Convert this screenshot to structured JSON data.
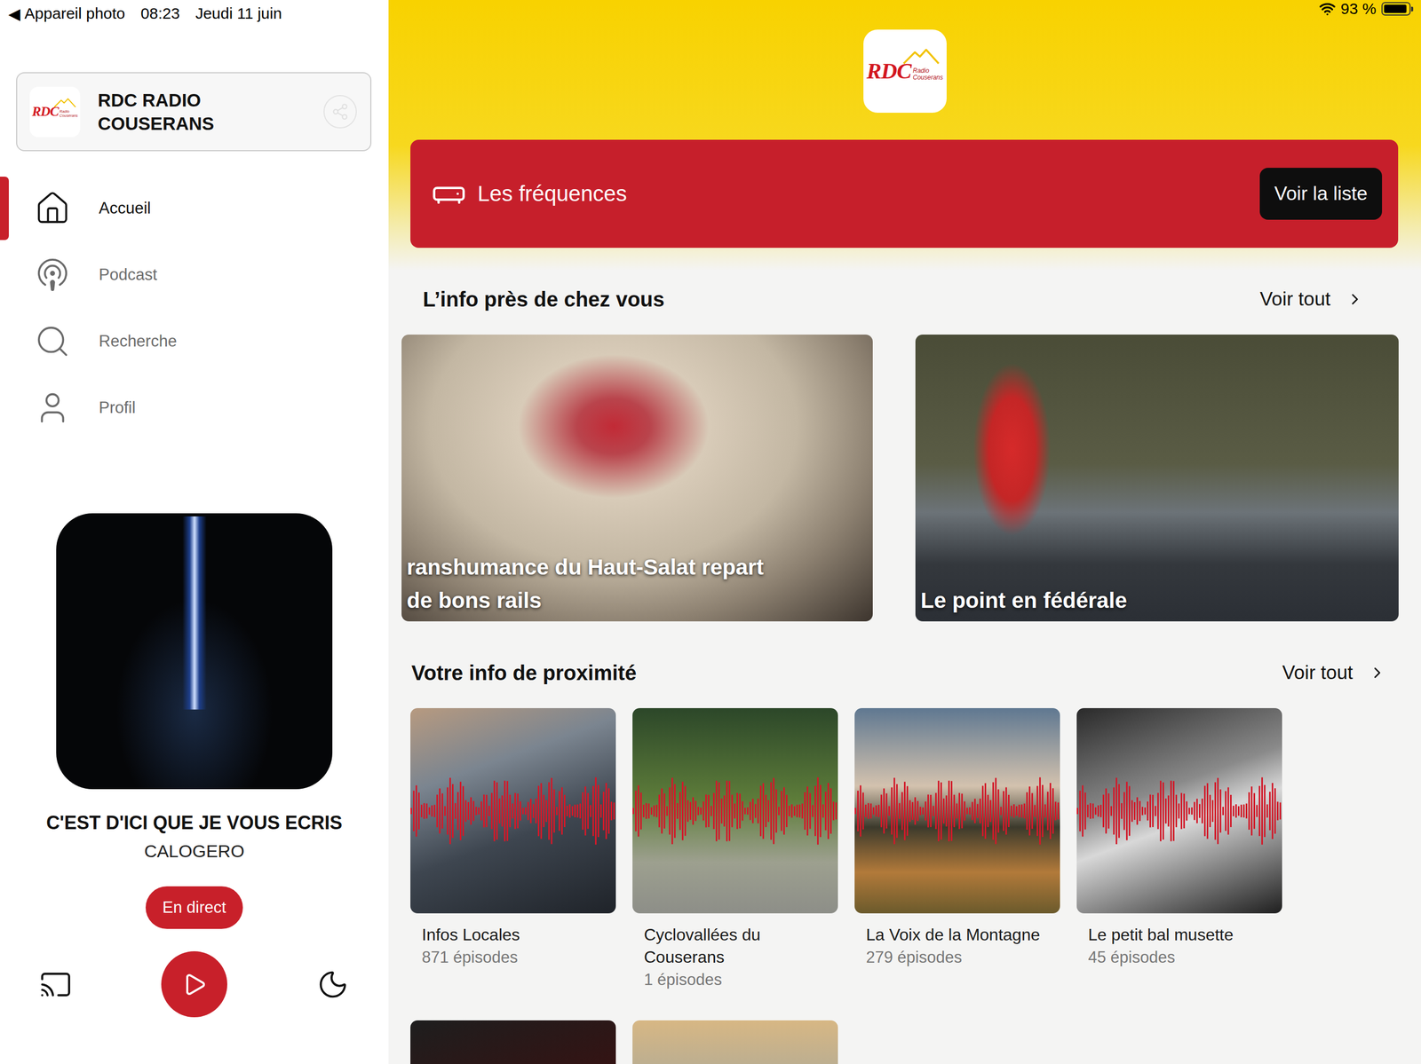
{
  "status_bar": {
    "back": "◀",
    "back_label": "Appareil photo",
    "time": "08:23",
    "date": "Jeudi 11 juin",
    "battery": "93 %",
    "battery_level": 0.93
  },
  "logo": {
    "mark": "RDC",
    "line1": "Radio",
    "line2": "Couserans"
  },
  "station": {
    "name_lines": [
      "RDC RADIO",
      "COUSERANS"
    ]
  },
  "nav": [
    {
      "label": "Accueil",
      "selected": true
    },
    {
      "label": "Podcast",
      "selected": false
    },
    {
      "label": "Recherche",
      "selected": false
    },
    {
      "label": "Profil",
      "selected": false
    }
  ],
  "now_playing": {
    "title": "C'EST D'ICI QUE JE VOUS ECRIS",
    "artist": "CALOGERO",
    "live_label": "En direct"
  },
  "frequencies": {
    "title": "Les fréquences",
    "button": "Voir la liste"
  },
  "sections": [
    {
      "title": "L’info près de chez vous",
      "see_all": "Voir tout"
    },
    {
      "title": "Votre info de proximité",
      "see_all": "Voir tout"
    }
  ],
  "news": [
    {
      "lines": [
        "ranshumance du Haut-Salat repart",
        "de bons rails"
      ]
    },
    {
      "lines": [
        "Le point en fédérale"
      ]
    }
  ],
  "podcasts": [
    {
      "kind": "show",
      "title": "Infos Locales",
      "episodes": "871 épisodes"
    },
    {
      "kind": "show",
      "title": "Cyclovallées du Couserans",
      "episodes": "1 épisodes"
    },
    {
      "kind": "show",
      "title": "La Voix de la Montagne",
      "episodes": "279 épisodes"
    },
    {
      "kind": "show",
      "title": "Le petit bal musette",
      "episodes": "45 épisodes"
    },
    {
      "kind": "partial"
    },
    {
      "kind": "partial"
    }
  ]
}
